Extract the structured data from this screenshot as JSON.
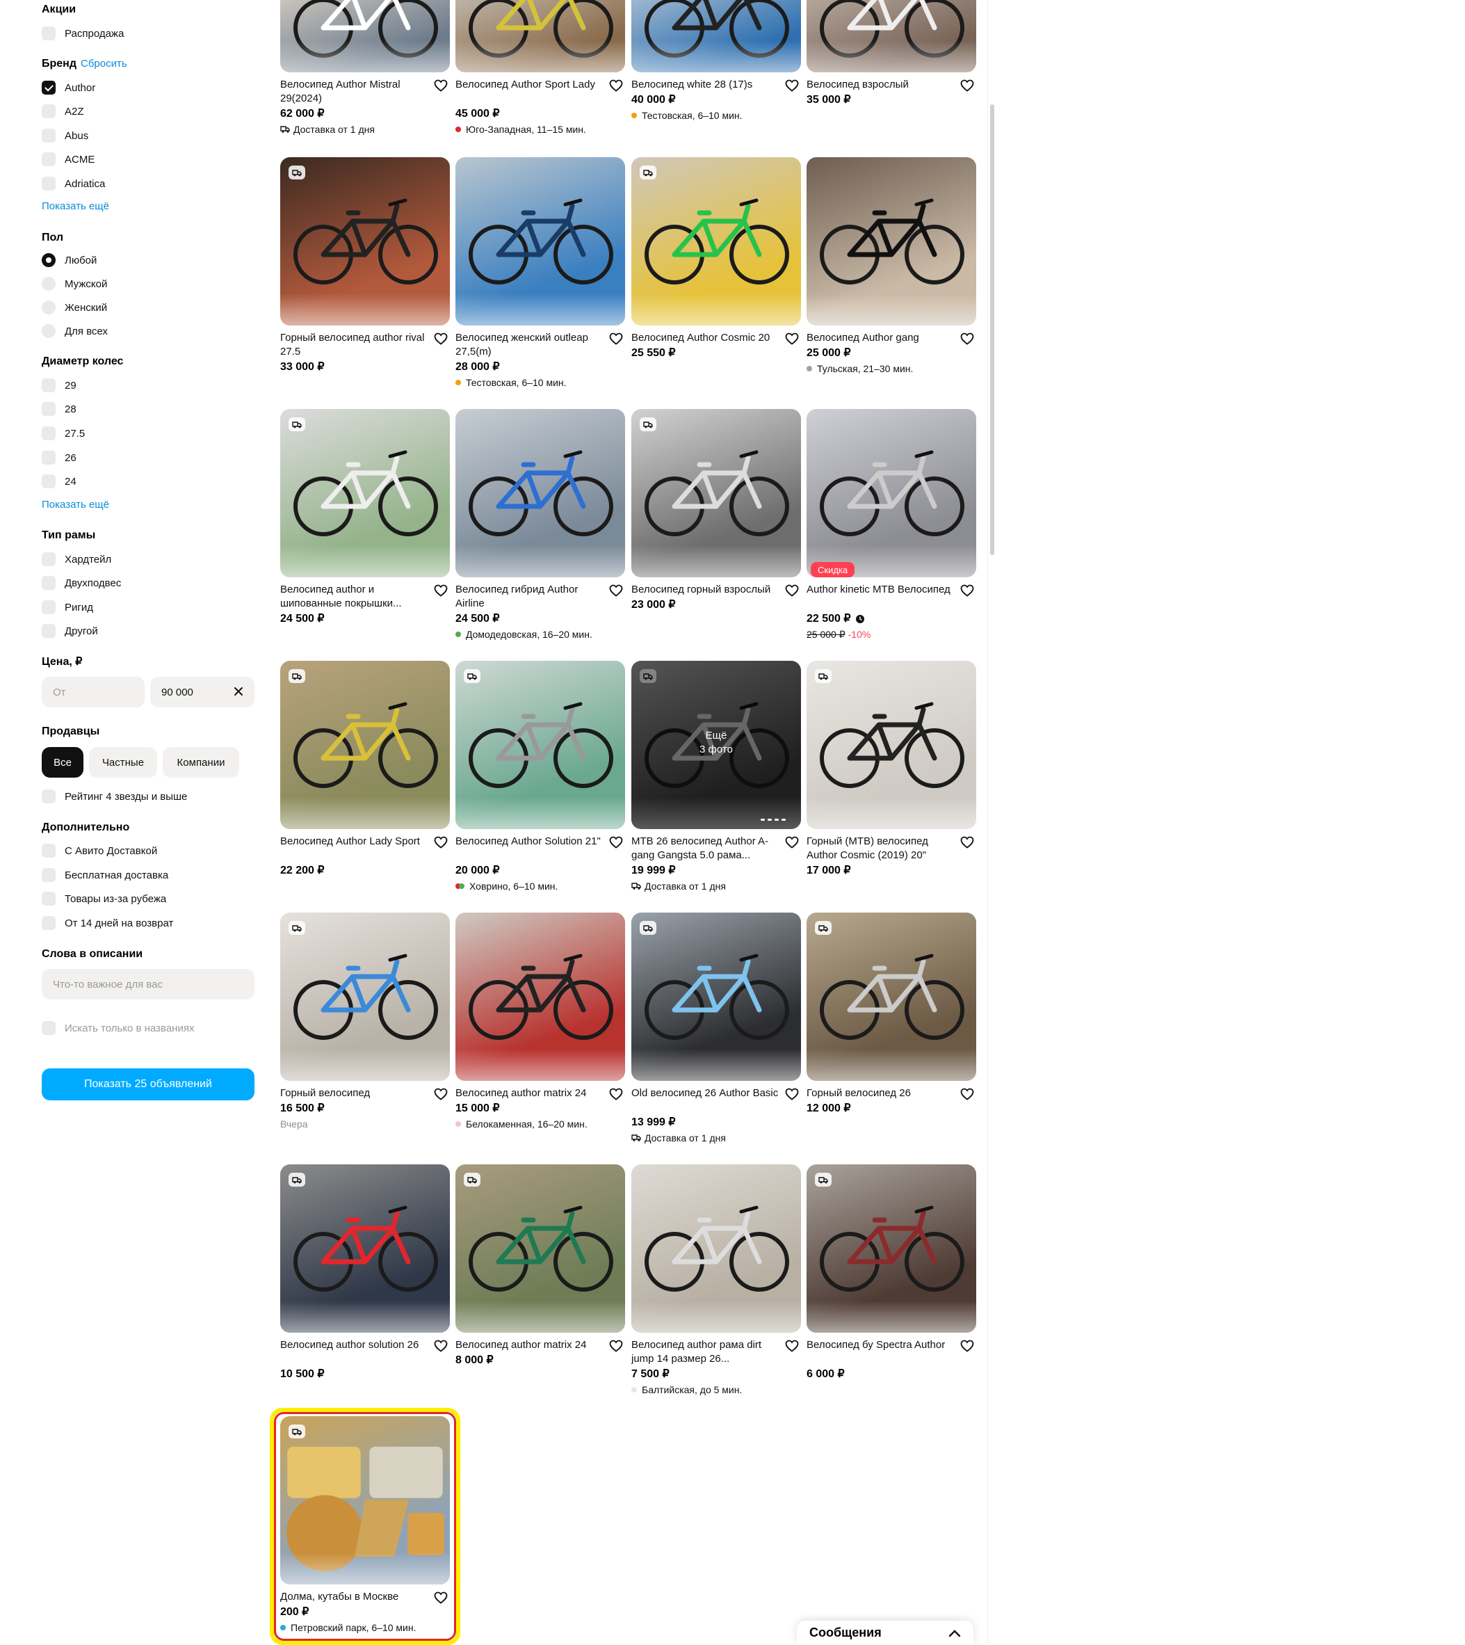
{
  "filters": {
    "promos": {
      "title": "Акции",
      "items": [
        {
          "label": "Распродажа",
          "checked": false
        }
      ]
    },
    "brand": {
      "title": "Бренд",
      "reset": "Сбросить",
      "items": [
        {
          "label": "Author",
          "checked": true
        },
        {
          "label": "A2Z",
          "checked": false
        },
        {
          "label": "Abus",
          "checked": false
        },
        {
          "label": "ACME",
          "checked": false
        },
        {
          "label": "Adriatica",
          "checked": false
        }
      ],
      "more": "Показать ещё"
    },
    "gender": {
      "title": "Пол",
      "items": [
        {
          "label": "Любой",
          "checked": true
        },
        {
          "label": "Мужской",
          "checked": false
        },
        {
          "label": "Женский",
          "checked": false
        },
        {
          "label": "Для всех",
          "checked": false
        }
      ]
    },
    "wheel": {
      "title": "Диаметр колес",
      "items": [
        {
          "label": "29",
          "checked": false
        },
        {
          "label": "28",
          "checked": false
        },
        {
          "label": "27.5",
          "checked": false
        },
        {
          "label": "26",
          "checked": false
        },
        {
          "label": "24",
          "checked": false
        }
      ],
      "more": "Показать ещё"
    },
    "frame": {
      "title": "Тип рамы",
      "items": [
        {
          "label": "Хардтейл",
          "checked": false
        },
        {
          "label": "Двухподвес",
          "checked": false
        },
        {
          "label": "Ригид",
          "checked": false
        },
        {
          "label": "Другой",
          "checked": false
        }
      ]
    },
    "price": {
      "title": "Цена, ₽",
      "from_placeholder": "От",
      "to_value": "90 000"
    },
    "sellers": {
      "title": "Продавцы",
      "segments": [
        {
          "label": "Все",
          "active": true
        },
        {
          "label": "Частные",
          "active": false
        },
        {
          "label": "Компании",
          "active": false
        }
      ],
      "rating": "Рейтинг 4 звезды и выше"
    },
    "extra": {
      "title": "Дополнительно",
      "items": [
        {
          "label": "С Авито Доставкой",
          "checked": false
        },
        {
          "label": "Бесплатная доставка",
          "checked": false
        },
        {
          "label": "Товары из-за рубежа",
          "checked": false
        },
        {
          "label": "От 14 дней на возврат",
          "checked": false
        }
      ]
    },
    "words": {
      "title": "Слова в описании",
      "placeholder": "Что-то важное для вас",
      "titles_only": "Искать только в названиях"
    },
    "show_button": "Показать 25 объявлений"
  },
  "listings": [
    {
      "title": "Велосипед Author Mistral 29(2024)",
      "price": "62 000 ₽",
      "meta": "Доставка от 1 дня",
      "meta_type": "delivery"
    },
    {
      "title": "Велосипед Author Sport Lady",
      "price": "45 000 ₽",
      "meta": "Юго-Западная, 11–15 мин.",
      "meta_type": "metro",
      "dot": "#e4262c"
    },
    {
      "title": "Велосипед white 28 (17)s",
      "price": "40 000 ₽",
      "meta": "Тестовская, 6–10 мин.",
      "meta_type": "metro",
      "dot": "#f0a30a"
    },
    {
      "title": "Велосипед взрослый",
      "price": "35 000 ₽"
    },
    {
      "title": "Горный велосипед author rival 27.5",
      "price": "33 000 ₽"
    },
    {
      "title": "Велосипед женский outleap 27,5(m)",
      "price": "28 000 ₽",
      "meta": "Тестовская, 6–10 мин.",
      "meta_type": "metro",
      "dot": "#f0a30a"
    },
    {
      "title": "Велосипед Author Cosmic 20",
      "price": "25 550 ₽"
    },
    {
      "title": "Велосипед Author gang",
      "price": "25 000 ₽",
      "meta": "Тульская, 21–30 мин.",
      "meta_type": "metro",
      "dot": "#a3a3a3"
    },
    {
      "title": "Велосипед author и шипованные покрышки...",
      "price": "24 500 ₽"
    },
    {
      "title": "Велосипед гибрид Author Airline",
      "price": "24 500 ₽",
      "meta": "Домодедовская, 16–20 мин.",
      "meta_type": "metro",
      "dot": "#4caf50"
    },
    {
      "title": "Велосипед горный взрослый",
      "price": "23 000 ₽"
    },
    {
      "title": "Author kinetic MTB Велосипед",
      "price": "22 500 ₽",
      "sale": "Скидка",
      "old_price": "25 000 ₽",
      "discount": "-10%"
    },
    {
      "title": "Велосипед Author Lady Sport",
      "price": "22 200 ₽"
    },
    {
      "title": "Велосипед Author Solution 21\"",
      "price": "20 000 ₽",
      "meta": "Ховрино, 6–10 мин.",
      "meta_type": "metro2"
    },
    {
      "title": "МТВ 26 велосипед Author A-gang Gangsta 5.0 рама...",
      "price": "19 999 ₽",
      "meta": "Доставка от 1 дня",
      "meta_type": "delivery",
      "more_photos": "Ещё\n3 фото"
    },
    {
      "title": "Горный (МТВ) велосипед Author Cosmic (2019) 20\"",
      "price": "17 000 ₽"
    },
    {
      "title": "Горный велосипед",
      "price": "16 500 ₽",
      "meta": "Вчера",
      "meta_type": "grey"
    },
    {
      "title": "Велосипед author matrix 24",
      "price": "15 000 ₽",
      "meta": "Белокаменная, 16–20 мин.",
      "meta_type": "metro",
      "dot": "#f6c6c6"
    },
    {
      "title": "Old велосипед 26 Author Basic",
      "price": "13 999 ₽",
      "meta": "Доставка от 1 дня",
      "meta_type": "delivery"
    },
    {
      "title": "Горный велосипед 26",
      "price": "12 000 ₽"
    },
    {
      "title": "Велосипед author solution 26",
      "price": "10 500 ₽"
    },
    {
      "title": "Велосипед author matrix 24",
      "price": "8 000 ₽"
    },
    {
      "title": "Велосипед author рама dirt jump 14 размер 26...",
      "price": "7 500 ₽",
      "meta": "Балтийская, до 5 мин.",
      "meta_type": "metro",
      "dot": "#e6e6e6"
    },
    {
      "title": "Велосипед бу Spectra Author",
      "price": "6 000 ₽"
    },
    {
      "title": "Долма, кутабы в Москве",
      "price": "200 ₽",
      "meta": "Петровский парк, 6–10 мин.",
      "meta_type": "metro",
      "dot": "#29a8e0"
    }
  ],
  "messages_panel": "Сообщения",
  "colors": {
    "accent": "#00aaff",
    "link": "#0a8cd9",
    "sale": "#ff4053"
  }
}
